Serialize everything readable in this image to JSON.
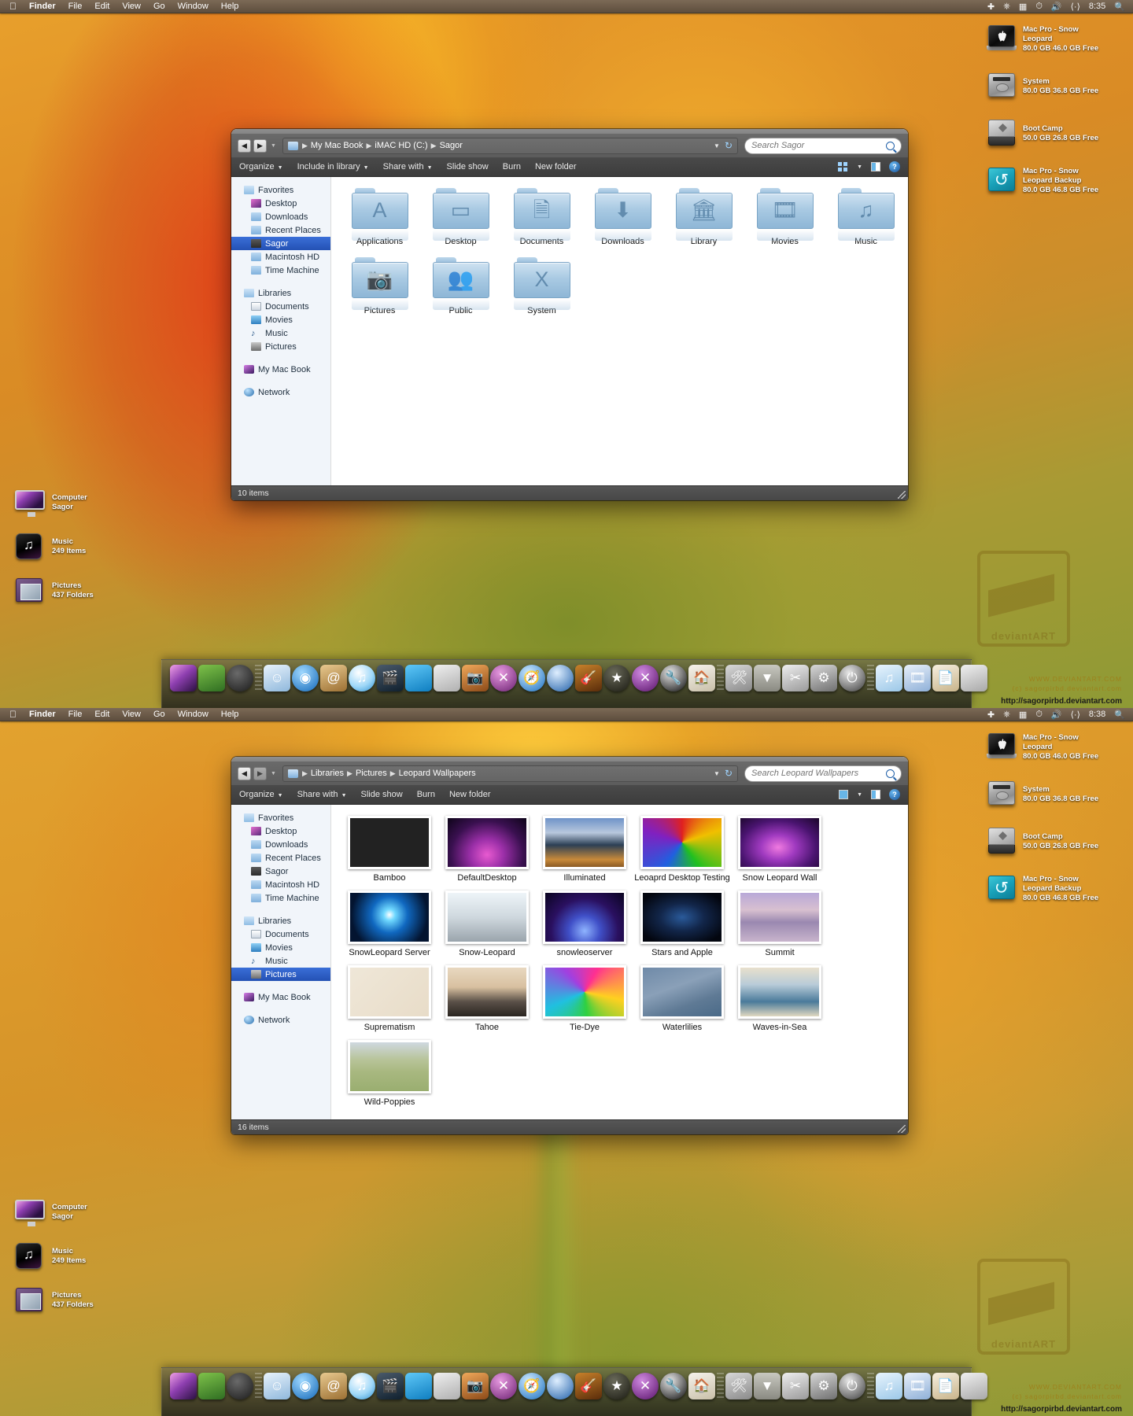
{
  "menubar": {
    "apple_icon": "apple-icon",
    "items": [
      "Finder",
      "File",
      "Edit",
      "View",
      "Go",
      "Window",
      "Help"
    ],
    "status_icons": [
      "plus-icon",
      "eject-icon",
      "display-icon",
      "time-machine-icon",
      "volume-icon",
      "input-icon"
    ],
    "clock_top": "8:35",
    "clock_bottom": "8:38",
    "search_icon": "spotlight-search-icon"
  },
  "drives": [
    {
      "icon": "apple-hard-drive-icon",
      "name_line1": "Mac Pro - Snow",
      "name_line2": "Leopard",
      "capacity": "80.0 GB 46.0 GB Free"
    },
    {
      "icon": "hard-drive-icon",
      "name_line1": "System",
      "name_line2": "",
      "capacity": "80.0 GB 36.8 GB Free"
    },
    {
      "icon": "windows-drive-icon",
      "name_line1": "Boot Camp",
      "name_line2": "",
      "capacity": "50.0 GB 26.8 GB Free"
    },
    {
      "icon": "time-machine-drive-icon",
      "name_line1": "Mac Pro - Snow",
      "name_line2": "Leopard Backup",
      "capacity": "80.0 GB 46.8 GB Free"
    }
  ],
  "desktop_icons": [
    {
      "icon": "computer-icon",
      "line1": "Computer",
      "line2": "Sagor"
    },
    {
      "icon": "music-folder-icon",
      "line1": "Music",
      "line2": "249 Items"
    },
    {
      "icon": "pictures-folder-icon",
      "line1": "Pictures",
      "line2": "437 Folders"
    }
  ],
  "window_top": {
    "breadcrumbs": [
      "My Mac Book",
      "iMAC HD (C:)",
      "Sagor"
    ],
    "search_placeholder": "Search Sagor",
    "toolbar": [
      {
        "label": "Organize",
        "caret": true
      },
      {
        "label": "Include in library",
        "caret": true
      },
      {
        "label": "Share with",
        "caret": true
      },
      {
        "label": "Slide show",
        "caret": false
      },
      {
        "label": "Burn",
        "caret": false
      },
      {
        "label": "New folder",
        "caret": false
      }
    ],
    "sidebar": {
      "groups": [
        {
          "header": "Favorites",
          "items": [
            "Desktop",
            "Downloads",
            "Recent Places",
            "Sagor",
            "Macintosh HD",
            "Time Machine"
          ],
          "selected": "Sagor"
        },
        {
          "header": "Libraries",
          "items": [
            "Documents",
            "Movies",
            "Music",
            "Pictures"
          ],
          "selected": ""
        }
      ],
      "standalone": [
        "My Mac Book",
        "Network"
      ]
    },
    "folders": [
      {
        "name": "Applications",
        "glyph": "A"
      },
      {
        "name": "Desktop",
        "glyph": "▭"
      },
      {
        "name": "Documents",
        "glyph": "🗎"
      },
      {
        "name": "Downloads",
        "glyph": "⬇"
      },
      {
        "name": "Library",
        "glyph": "🏛"
      },
      {
        "name": "Movies",
        "glyph": "🎞"
      },
      {
        "name": "Music",
        "glyph": "♫"
      },
      {
        "name": "Pictures",
        "glyph": "📷"
      },
      {
        "name": "Public",
        "glyph": "👥"
      },
      {
        "name": "System",
        "glyph": "X"
      }
    ],
    "status": "10 items"
  },
  "window_bottom": {
    "breadcrumbs": [
      "Libraries",
      "Pictures",
      "Leopard Wallpapers"
    ],
    "search_placeholder": "Search Leopard Wallpapers",
    "toolbar": [
      {
        "label": "Organize",
        "caret": true
      },
      {
        "label": "Share with",
        "caret": true
      },
      {
        "label": "Slide show",
        "caret": false
      },
      {
        "label": "Burn",
        "caret": false
      },
      {
        "label": "New folder",
        "caret": false
      }
    ],
    "sidebar": {
      "groups": [
        {
          "header": "Favorites",
          "items": [
            "Desktop",
            "Downloads",
            "Recent Places",
            "Sagor",
            "Macintosh HD",
            "Time Machine"
          ],
          "selected": ""
        },
        {
          "header": "Libraries",
          "items": [
            "Documents",
            "Movies",
            "Music",
            "Pictures"
          ],
          "selected": "Pictures"
        }
      ],
      "standalone": [
        "My Mac Book",
        "Network"
      ]
    },
    "wallpapers": [
      {
        "name": "Bamboo",
        "css": "linear-gradient(100deg,#c0392b 0%,#8eae4a 25%,#d04a20 48%,#a8b martin 60%,#7d9b3a 100%)"
      },
      {
        "name": "DefaultDesktop",
        "css": "radial-gradient(ellipse at 50% 75%, #e85ad0 0%, #9b2fa8 30%, #3a1050 65%, #0d0418 100%)"
      },
      {
        "name": "Illuminated",
        "css": "linear-gradient(180deg,#6f93c8 0%,#b8c8dd 30%,#2c3f55 55%,#c88a3a 85%,#8a5a24 100%)"
      },
      {
        "name": "Leoaprd Desktop Testing",
        "css": "conic-gradient(from 0deg,#e02020,#f0c000,#20c020,#2060e0,#8020c0,#e02020)"
      },
      {
        "name": "Snow Leopard Wall",
        "css": "radial-gradient(ellipse at 48% 60%, #f07ae0 0%, #a03ac0 30%, #4a1470 65%, #1a0628 100%)"
      },
      {
        "name": "SnowLeopard Server",
        "css": "radial-gradient(circle at 50% 45%, #ffffff 0%, #6fd8ff 12%, #1068c0 38%, #031430 80%)"
      },
      {
        "name": "Snow-Leopard",
        "css": "linear-gradient(180deg,#eef4f8 0%,#cfd8de 50%,#9aa4ac 100%)"
      },
      {
        "name": "snowleoserver",
        "css": "radial-gradient(ellipse at 50% 78%, #8fb4ff 0%, #4050c8 28%, #2a1060 60%, #0a0420 100%)"
      },
      {
        "name": "Stars and Apple",
        "css": "radial-gradient(ellipse at 50% 50%, #2a5a9a 0%, #12264a 40%, #03060f 85%)"
      },
      {
        "name": "Summit",
        "css": "linear-gradient(180deg,#b8a8d8 0%,#d8c0d0 35%,#9a88b0 60%,#c8b4cc 100%)"
      },
      {
        "name": "Suprematism",
        "css": "linear-gradient(135deg,#efe7d8 0%,#e8dcc8 100%)"
      },
      {
        "name": "Tahoe",
        "css": "linear-gradient(180deg,#e8d8c0 0%,#d8c0a0 40%,#5a5048 70%,#2a2520 100%)"
      },
      {
        "name": "Tie-Dye",
        "css": "conic-gradient(from 30deg,#ff3090,#ffd020,#30d040,#20c0e0,#a040e0,#ff3090)"
      },
      {
        "name": "Waterlilies",
        "css": "linear-gradient(160deg,#6f8aa8 0%,#8aa0b8 40%,#5f7a95 70%,#4a6a88 100%)"
      },
      {
        "name": "Waves-in-Sea",
        "css": "linear-gradient(180deg,#e8e0cc 0%,#b8cbd8 35%,#4a7a9a 70%,#e0d8c0 100%)"
      },
      {
        "name": "Wild-Poppies",
        "css": "linear-gradient(180deg,#cfd8e0 0%,#b8c49a 35%,#a8b880 60%,#9aae70 100%)"
      }
    ],
    "status": "16 items"
  },
  "dock": {
    "items": [
      "computer-display-icon",
      "finder-grass-icon",
      "dashboard-gauge-icon",
      "separator",
      "finder-face-icon",
      "dvd-player-icon",
      "address-book-icon",
      "itunes-icon",
      "imovie-icon",
      "front-row-chair-icon",
      "iphoto-icon",
      "photobooth-camera-icon",
      "xcode-icon",
      "safari-icon",
      "firefox-icon",
      "garageband-icon",
      "imovie-star-icon",
      "x11-icon",
      "utilities-icon",
      "home-icon",
      "separator",
      "developer-tools-icon",
      "downloads-stack-icon",
      "scissors-icon",
      "preferences-icon",
      "power-icon",
      "separator",
      "music-stack-icon",
      "movies-stack-icon",
      "documents-stack-icon",
      "trash-icon"
    ]
  },
  "watermark": {
    "logo_text": "deviantART",
    "url_line1": "WWW.DEVIANTART.COM",
    "url_line2": "(c) sagorpirbd.deviantart.com",
    "link": "http://sagorpirbd.deviantart.com"
  }
}
